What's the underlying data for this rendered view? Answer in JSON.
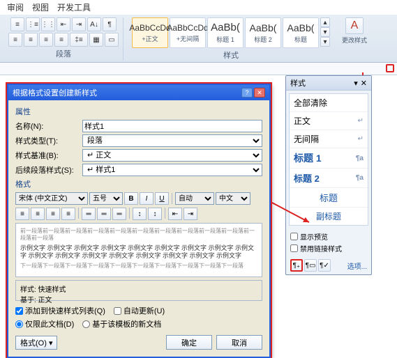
{
  "tabs": [
    "审阅",
    "视图",
    "开发工具"
  ],
  "paragraph_label": "段落",
  "styles_label": "样式",
  "change_styles": "更改样式",
  "gallery": [
    {
      "preview": "AaBbCcDd",
      "label": "+正文",
      "sel": true
    },
    {
      "preview": "AaBbCcDd",
      "label": "+无间隔"
    },
    {
      "preview": "AaBb(",
      "label": "标题 1"
    },
    {
      "preview": "AaBb(",
      "label": "标题 2"
    },
    {
      "preview": "AaBb(",
      "label": "标题"
    }
  ],
  "pane": {
    "title": "样式",
    "items": [
      {
        "label": "全部清除",
        "cls": ""
      },
      {
        "label": "正文",
        "cls": ""
      },
      {
        "label": "无间隔",
        "cls": ""
      },
      {
        "label": "标题 1",
        "cls": "h1"
      },
      {
        "label": "标题 2",
        "cls": "h2"
      },
      {
        "label": "标题",
        "cls": "tt"
      },
      {
        "label": "副标题",
        "cls": "st"
      }
    ],
    "show_preview": "显示预览",
    "disable_linked": "禁用链接样式",
    "options": "选项..."
  },
  "dlg": {
    "title": "根据格式设置创建新样式",
    "props": "属性",
    "name_lbl": "名称(N):",
    "name_val": "样式1",
    "type_lbl": "样式类型(T):",
    "type_val": "段落",
    "base_lbl": "样式基准(B):",
    "base_val": "↵ 正文",
    "follow_lbl": "后续段落样式(S):",
    "follow_val": "↵ 样式1",
    "format": "格式",
    "font": "宋体 (中文正文)",
    "size": "五号",
    "auto": "自动",
    "lang": "中文",
    "preview_gray": "前一段落前一段落前一段落前一段落前一段落前一段落前一段落前一段落前一段落前一段落前一段落前一段落",
    "preview_mid": "示例文字 示例文字 示例文字 示例文字 示例文字 示例文字 示例文字 示例文字 示例文字 示例文字 示例文字 示例文字 示例文字 示例文字 示例文字 示例文字 示例文字",
    "preview_gray2": "下一段落下一段落下一段落下一段落下一段落下一段落下一段落下一段落下一段落下一段落",
    "desc1": "样式: 快速样式",
    "desc2": "基于: 正文",
    "add_quick": "添加到快速样式列表(Q)",
    "auto_update": "自动更新(U)",
    "only_doc": "仅限此文档(D)",
    "based_template": "基于该模板的新文档",
    "format_btn": "格式(O) ▾",
    "ok": "确定",
    "cancel": "取消"
  }
}
